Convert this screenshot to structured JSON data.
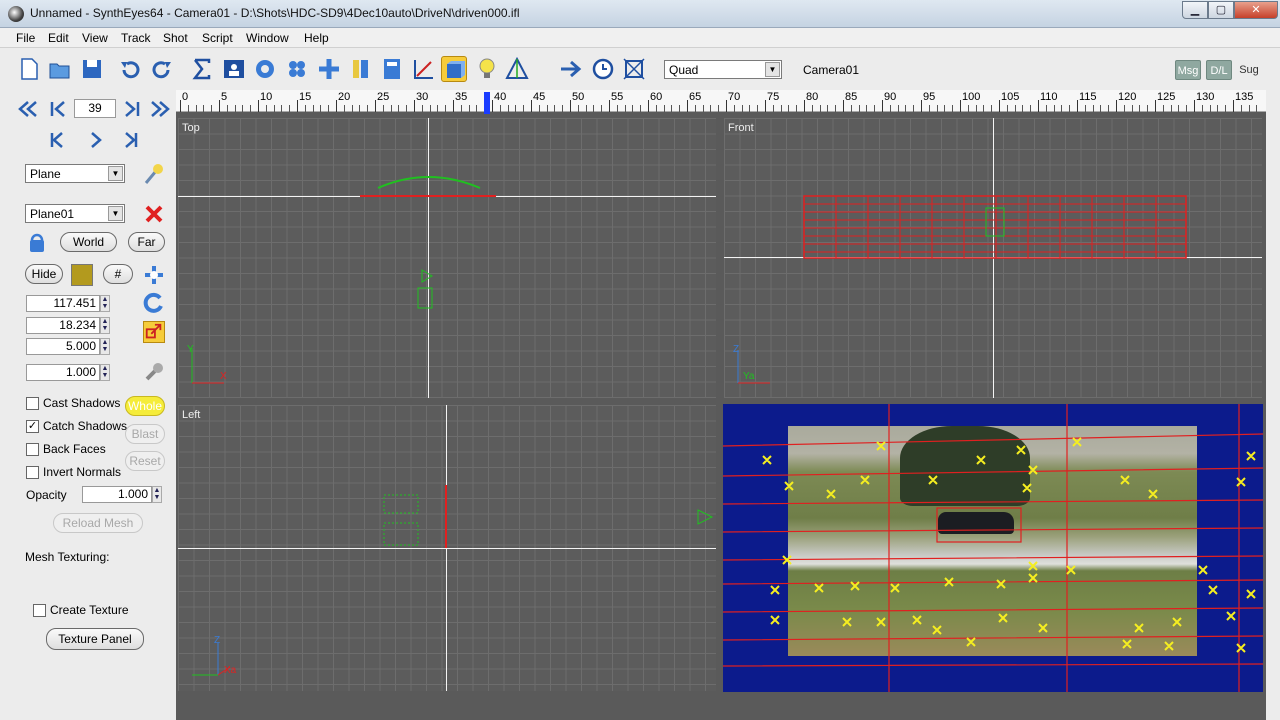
{
  "window": {
    "title": "Unnamed - SynthEyes64 - Camera01 - D:\\Shots\\HDC-SD9\\4Dec10auto\\DriveN\\driven000.ifl",
    "minimize": "▁",
    "maximize": "▢",
    "close": "✕"
  },
  "menu": [
    "File",
    "Edit",
    "View",
    "Track",
    "Shot",
    "Script",
    "Window",
    "Help"
  ],
  "toolbar": {
    "view_layout": "Quad",
    "camera": "Camera01",
    "msg": "Msg",
    "dl": "D/L",
    "sug": "Sug"
  },
  "timeline": {
    "current_frame": "39",
    "ticks": [
      "0",
      "5",
      "10",
      "15",
      "20",
      "25",
      "30",
      "35",
      "40",
      "45",
      "50",
      "55",
      "60",
      "65",
      "70",
      "75",
      "80",
      "85",
      "90",
      "95",
      "100",
      "105",
      "110",
      "115",
      "120",
      "125",
      "130",
      "135"
    ]
  },
  "panel": {
    "object_type": "Plane",
    "object_name": "Plane01",
    "world": "World",
    "far": "Far",
    "hide": "Hide",
    "hash": "#",
    "color": "#b39a1e",
    "x": "117.451",
    "y": "18.234",
    "z": "5.000",
    "scale": "1.000",
    "cast_shadows": "Cast Shadows",
    "catch_shadows": "Catch Shadows",
    "back_faces": "Back Faces",
    "invert_normals": "Invert Normals",
    "whole": "Whole",
    "blast": "Blast",
    "reset": "Reset",
    "opacity_label": "Opacity",
    "opacity": "1.000",
    "reload_mesh": "Reload Mesh",
    "mesh_texturing": "Mesh Texturing:",
    "create_texture": "Create Texture",
    "texture_panel": "Texture Panel",
    "catch_shadows_checked": true
  },
  "viewports": {
    "top": "Top",
    "front": "Front",
    "left": "Left",
    "axis_y": "Y",
    "axis_z": "Z",
    "axis_x": "X",
    "axis_ya": "Ya",
    "axis_za": "Z",
    "axis_xa": "Xa"
  }
}
